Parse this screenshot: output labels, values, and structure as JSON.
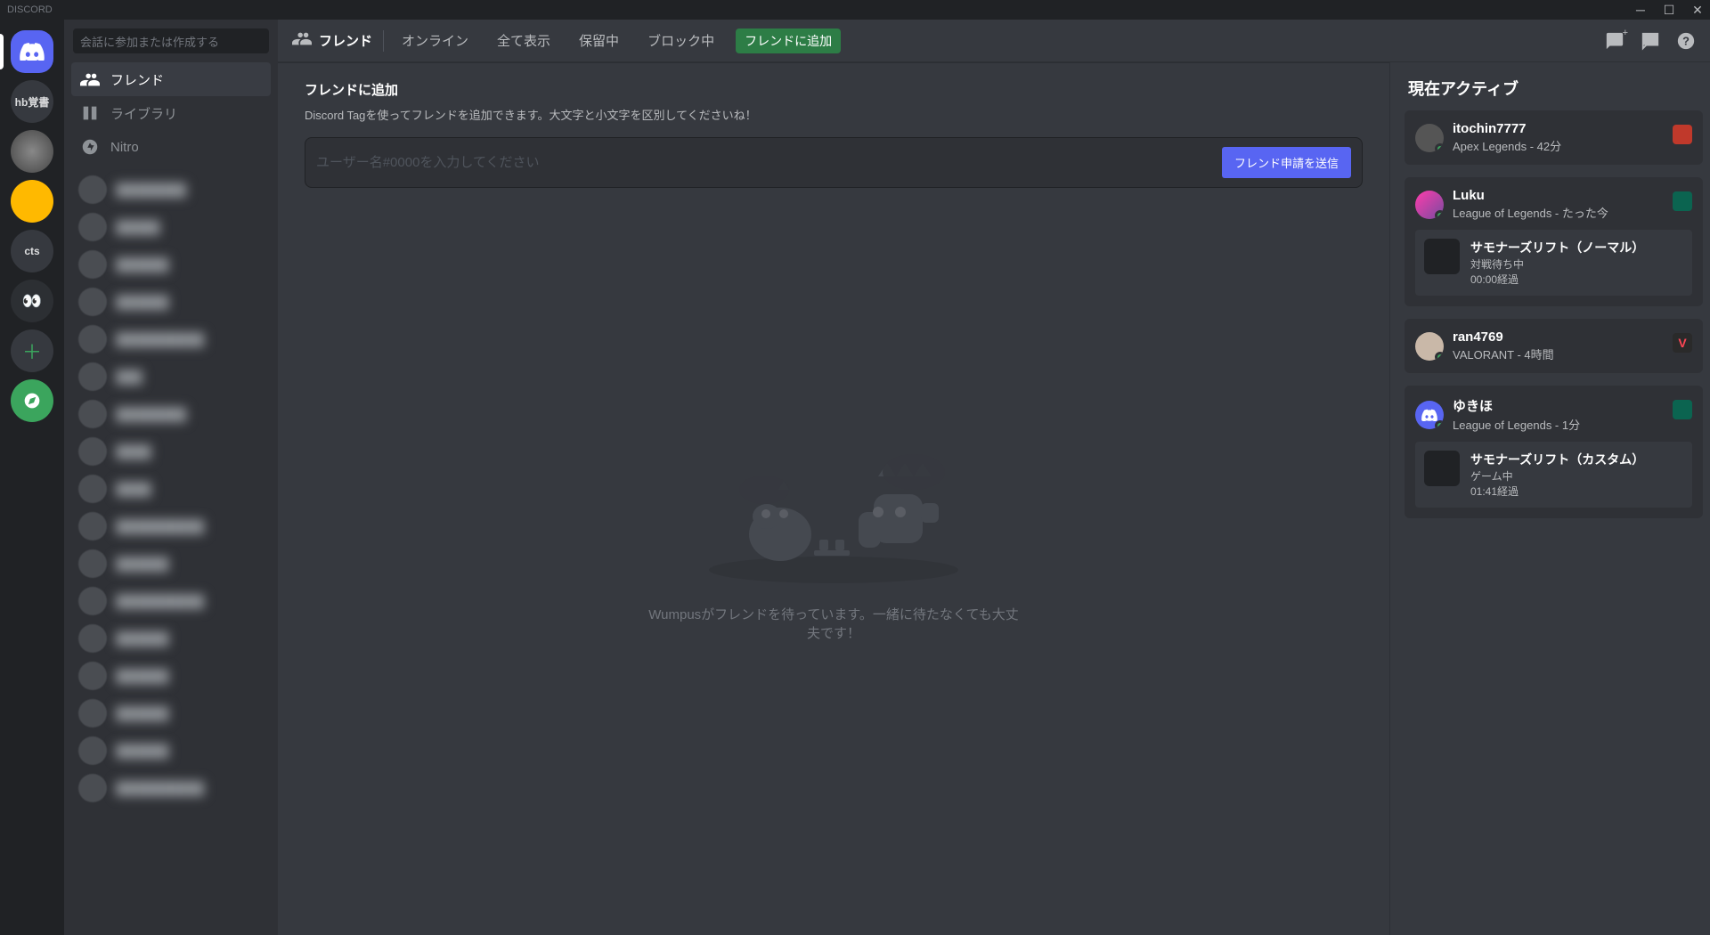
{
  "window": {
    "title": "DISCORD"
  },
  "servers": {
    "items": [
      {
        "id": "home",
        "kind": "home"
      },
      {
        "id": "s1",
        "kind": "txt",
        "label": "hb覚書"
      },
      {
        "id": "s2",
        "kind": "img1"
      },
      {
        "id": "s3",
        "kind": "img2"
      },
      {
        "id": "s4",
        "kind": "txt",
        "label": "cts"
      },
      {
        "id": "s5",
        "kind": "img4"
      },
      {
        "id": "add",
        "kind": "add"
      },
      {
        "id": "explore",
        "kind": "explore"
      }
    ]
  },
  "sidebar": {
    "search_placeholder": "会話に参加または作成する",
    "nav": {
      "friends": "フレンド",
      "library": "ライブラリ",
      "nitro": "Nitro"
    }
  },
  "topbar": {
    "title": "フレンド",
    "tabs": {
      "online": "オンライン",
      "all": "全て表示",
      "pending": "保留中",
      "blocked": "ブロック中",
      "add_friend": "フレンドに追加"
    }
  },
  "add_friend": {
    "title": "フレンドに追加",
    "desc": "Discord Tagを使ってフレンドを追加できます。大文字と小文字を区別してくださいね！",
    "placeholder": "ユーザー名#0000を入力してください",
    "button": "フレンド申請を送信"
  },
  "empty": {
    "text": "Wumpusがフレンドを待っています。一緒に待たなくても大丈夫です！"
  },
  "activity": {
    "title": "現在アクティブ",
    "cards": [
      {
        "name": "itochin7777",
        "game": "Apex Legends - 42分",
        "game_icon": "apex"
      },
      {
        "name": "Luku",
        "game": "League of Legends - たった今",
        "game_icon": "lol",
        "sub": {
          "title": "サモナーズリフト（ノーマル）",
          "line1": "対戦待ち中",
          "line2": "00:00経過"
        }
      },
      {
        "name": "ran4769",
        "game": "VALORANT - 4時間",
        "game_icon": "val"
      },
      {
        "name": "ゆきほ",
        "game": "League of Legends - 1分",
        "game_icon": "lol",
        "avatar": "discord",
        "sub": {
          "title": "サモナーズリフト（カスタム）",
          "line1": "ゲーム中",
          "line2": "01:41経過"
        }
      }
    ]
  }
}
